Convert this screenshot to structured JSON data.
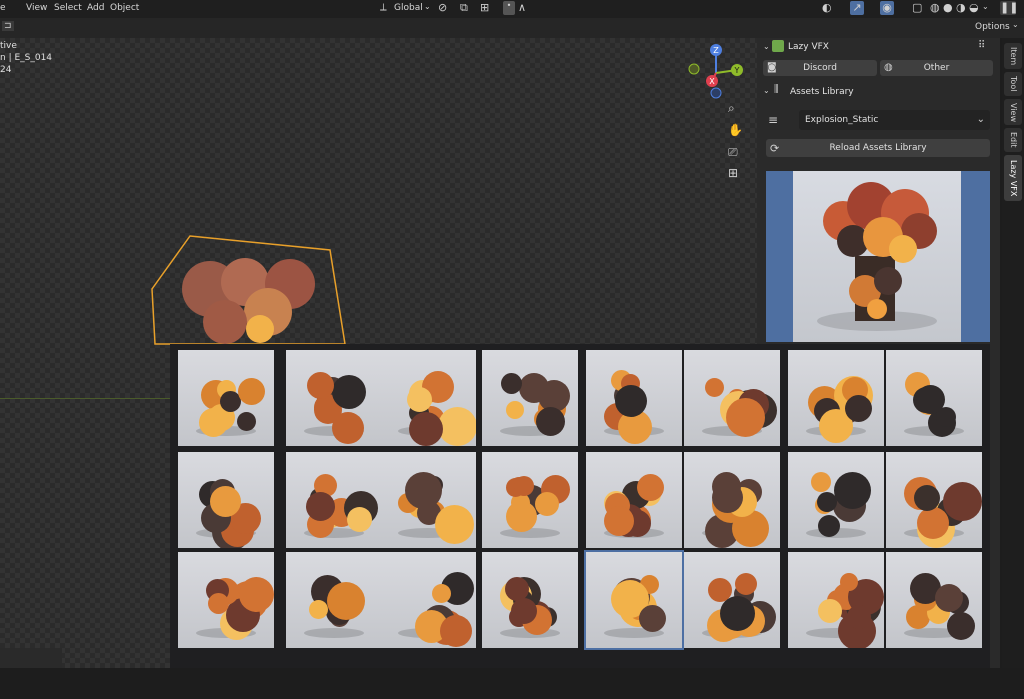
{
  "topbar": {
    "menus": [
      "e",
      "View",
      "Select",
      "Add",
      "Object"
    ],
    "orientation": "Global",
    "options": "Options"
  },
  "viewport_info": {
    "line1": "tive",
    "line2": "n | E_S_014",
    "line3": "24"
  },
  "gizmo": {
    "z": "Z",
    "y": "Y",
    "x": "X"
  },
  "sidebar": {
    "tabs": [
      "Item",
      "Tool",
      "View",
      "Edit",
      "Lazy VFX"
    ],
    "addon_title": "Lazy VFX",
    "discord_label": "Discord",
    "other_label": "Other",
    "assets_header": "Assets Library",
    "category_value": "Explosion_Static",
    "reload_label": "Reload Assets Library"
  },
  "thumbnail_grid": {
    "rows": 3,
    "columns": 8,
    "selected_index": 20
  },
  "colors": {
    "accent_blue": "#4e6fa1",
    "fire_orange": "#e07a2a",
    "selection_outline": "#e8a02a"
  }
}
